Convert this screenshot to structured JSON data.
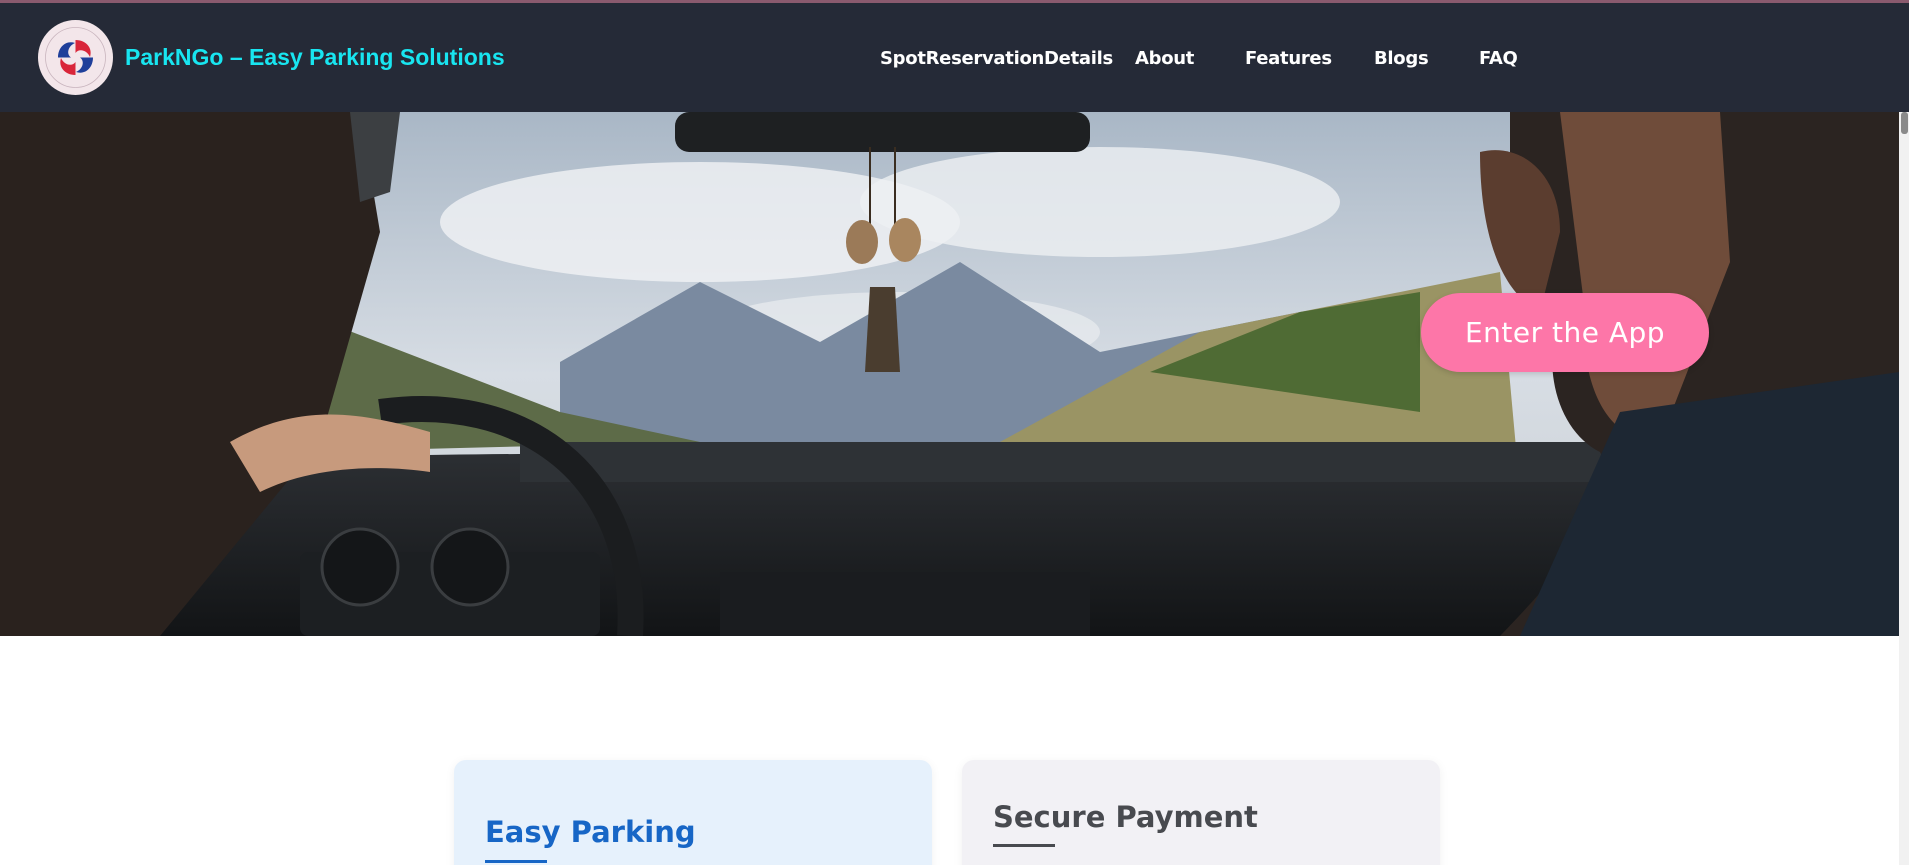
{
  "header": {
    "brand": "ParkNGo – Easy Parking Solutions",
    "nav": [
      {
        "label": "SpotReservationDetails"
      },
      {
        "label": "About"
      },
      {
        "label": "Features"
      },
      {
        "label": "Blogs"
      },
      {
        "label": "FAQ"
      }
    ]
  },
  "hero": {
    "cta_label": "Enter the App"
  },
  "features": [
    {
      "title": "Easy Parking"
    },
    {
      "title": "Secure Payment"
    }
  ],
  "colors": {
    "navbar_bg": "#252a37",
    "brand_text": "#18e5f0",
    "cta_bg": "#fd76a8",
    "card_easy_title": "#1766c6",
    "card_secure_title": "#484a4f"
  },
  "icons": {
    "logo": "parkngo-logo-icon"
  }
}
